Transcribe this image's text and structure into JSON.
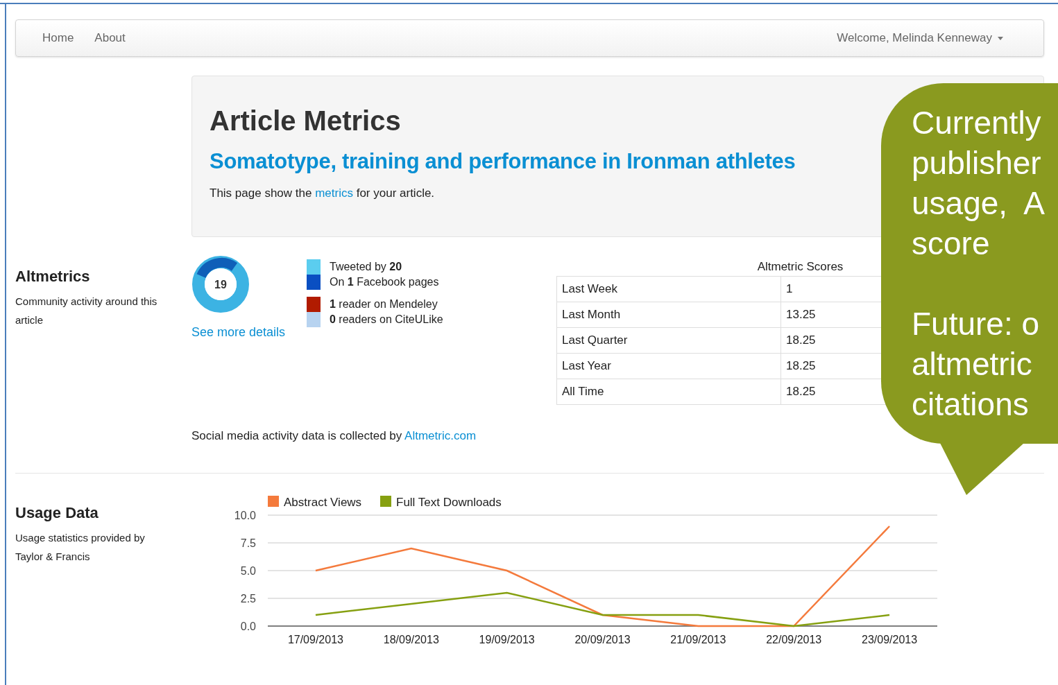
{
  "navbar": {
    "links": [
      "Home",
      "About"
    ],
    "user_menu": "Welcome, Melinda Kenneway"
  },
  "header": {
    "title": "Article Metrics",
    "article_title": "Somatotype, training and performance in Ironman athletes",
    "intro": {
      "before": "This page show the",
      "link": "metrics",
      "after": "for your article."
    }
  },
  "altmetrics": {
    "heading": "Altmetrics",
    "description": "Community activity around this article",
    "score": "19",
    "details_link": "See more details",
    "sources": [
      {
        "text": "Tweeted by **20**",
        "color": "#5bcdef"
      },
      {
        "text": "On **1** Facebook pages",
        "color": "#0a4fc2"
      },
      {
        "text": "**1** reader on Mendeley",
        "color": "#b11b00"
      },
      {
        "text": "**0** readers on CiteULike",
        "color": "#b7d3f0"
      }
    ],
    "scores_table": {
      "caption": "Altmetric Scores",
      "rows": [
        [
          "Last Week",
          "1"
        ],
        [
          "Last Month",
          "13.25"
        ],
        [
          "Last Quarter",
          "18.25"
        ],
        [
          "Last Year",
          "18.25"
        ],
        [
          "All Time",
          "18.25"
        ]
      ]
    },
    "credit": {
      "before": "Social media activity data is collected by",
      "link": "Altmetric.com"
    }
  },
  "usage": {
    "heading": "Usage Data",
    "description": "Usage statistics provided by Taylor & Francis",
    "chart_data": {
      "type": "line",
      "grid": true,
      "legend": true,
      "categories": [
        "17/09/2013",
        "18/09/2013",
        "19/09/2013",
        "20/09/2013",
        "21/09/2013",
        "22/09/2013",
        "23/09/2013"
      ],
      "ylim": [
        0,
        10
      ],
      "yticks": [
        {
          "value": 0,
          "label": "0.0"
        },
        {
          "value": 2.5,
          "label": "2.5"
        },
        {
          "value": 5,
          "label": "5.0"
        },
        {
          "value": 7.5,
          "label": "7.5"
        },
        {
          "value": 10,
          "label": "10.0"
        }
      ],
      "series": [
        {
          "name": "Abstract Views",
          "color": "#f47a3c",
          "values": [
            5,
            7,
            5,
            1,
            0,
            0,
            9
          ]
        },
        {
          "name": "Full Text Downloads",
          "color": "#86a011",
          "values": [
            1,
            2,
            3,
            1,
            1,
            0,
            1
          ]
        }
      ]
    }
  },
  "callout": {
    "paragraphs": [
      [
        "Currently",
        "publisher",
        "usage,  A",
        "score"
      ],
      [
        "Future: o",
        "altmetric",
        "citations"
      ]
    ]
  }
}
